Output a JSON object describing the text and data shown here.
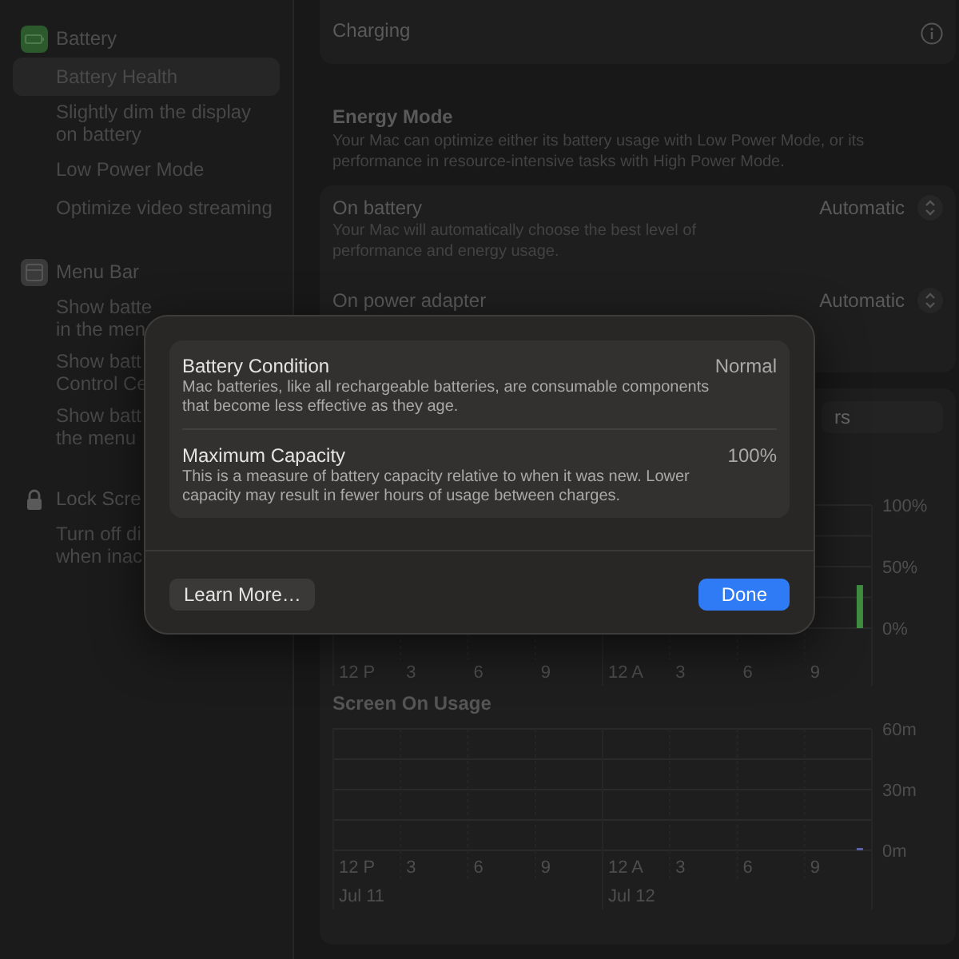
{
  "sidebar": {
    "items": [
      {
        "kind": "section",
        "lines": [
          "Battery"
        ]
      },
      {
        "kind": "item",
        "lines": [
          "Battery Health"
        ],
        "selected": true
      },
      {
        "kind": "item",
        "lines": [
          "Slightly dim the display",
          "on battery"
        ],
        "selected": false
      },
      {
        "kind": "item",
        "lines": [
          "Low Power Mode"
        ],
        "selected": false
      },
      {
        "kind": "item",
        "lines": [
          "Optimize video streaming"
        ],
        "selected": false
      },
      {
        "kind": "section",
        "lines": [
          "Menu Bar"
        ]
      },
      {
        "kind": "item",
        "lines": [
          "Show batte",
          "in the men"
        ],
        "selected": false
      },
      {
        "kind": "item",
        "lines": [
          "Show batt",
          "Control Ce"
        ],
        "selected": false
      },
      {
        "kind": "item",
        "lines": [
          "Show batt",
          "the menu"
        ],
        "selected": false
      },
      {
        "kind": "section",
        "lines": [
          "Lock Scre"
        ]
      },
      {
        "kind": "item",
        "lines": [
          "Turn off di",
          "when inac"
        ],
        "selected": false
      }
    ]
  },
  "charging": {
    "label": "Charging"
  },
  "energy_mode": {
    "title": "Energy Mode",
    "description": "Your Mac can optimize either its battery usage with Low Power Mode, or its performance in resource-intensive tasks with High Power Mode.",
    "rows": [
      {
        "label": "On battery",
        "description": "Your Mac will automatically choose the best level of performance and energy usage.",
        "value": "Automatic"
      },
      {
        "label": "On power adapter",
        "value": "Automatic"
      }
    ]
  },
  "usage": {
    "segment_label": "rs",
    "battery_chart": {
      "y_labels": [
        "100%",
        "50%",
        "0%"
      ],
      "x_labels": [
        "12 P",
        "3",
        "6",
        "9",
        "12 A",
        "3",
        "6",
        "9"
      ]
    },
    "screen_on_usage": {
      "title": "Screen On Usage",
      "y_labels": [
        "60m",
        "30m",
        "0m"
      ],
      "x_labels": [
        "12 P",
        "3",
        "6",
        "9",
        "12 A",
        "3",
        "6",
        "9"
      ],
      "dates": [
        "Jul 11",
        "Jul 12"
      ]
    }
  },
  "dialog": {
    "rows": [
      {
        "title": "Battery Condition",
        "description": "Mac batteries, like all rechargeable batteries, are consumable components that become less effective as they age.",
        "value": "Normal"
      },
      {
        "title": "Maximum Capacity",
        "description": "This is a measure of battery capacity relative to when it was new. Lower capacity may result in fewer hours of usage between charges.",
        "value": "100%"
      }
    ],
    "buttons": [
      {
        "label": "Learn More…",
        "kind": "secondary"
      },
      {
        "label": "Done",
        "kind": "primary"
      }
    ]
  }
}
